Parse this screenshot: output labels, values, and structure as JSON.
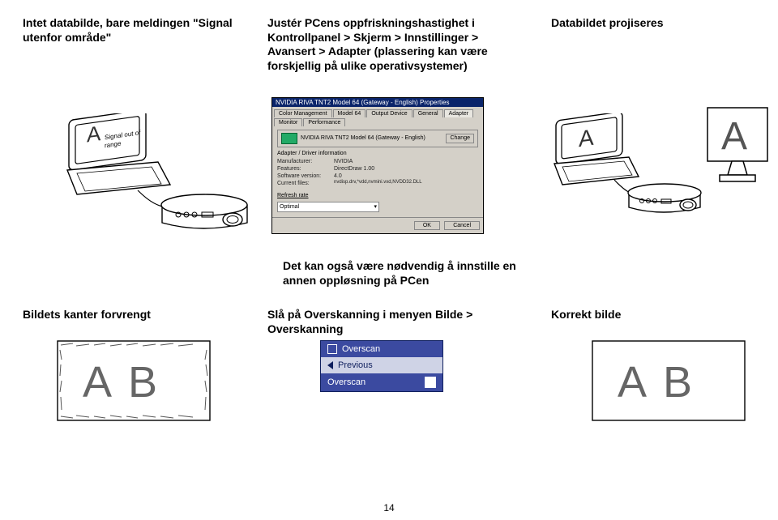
{
  "row1": {
    "left_heading": "Intet databilde, bare meldingen \"Signal utenfor område\"",
    "mid_text": "Justér PCens oppfriskningshastighet i Kontrollpanel > Skjerm > Innstillinger > Avansert > Adapter (plassering kan være forskjellig på ulike operativsystemer)",
    "right_heading": "Databildet projiseres",
    "signal_msg_line1": "Signal out of",
    "signal_msg_line2": "range",
    "screen_A_left": "A",
    "screen_A_right": "A",
    "monitor_A": "A",
    "dialog": {
      "title": "NVIDIA RIVA TNT2 Model 64 (Gateway - English) Properties",
      "tabs_row1": [
        "Color Management",
        "Model 64",
        "Output Device"
      ],
      "tabs_row2": [
        "General",
        "Adapter",
        "Monitor",
        "Performance"
      ],
      "active_tab": "Adapter",
      "card_name": "NVIDIA RIVA TNT2 Model 64 (Gateway - English)",
      "change_btn": "Change",
      "section": "Adapter / Driver information",
      "kv": [
        {
          "k": "Manufacturer:",
          "v": "NVIDIA"
        },
        {
          "k": "Features:",
          "v": "DirectDraw 1.00"
        },
        {
          "k": "Software version:",
          "v": "4.0"
        },
        {
          "k": "Current files:",
          "v": "nvdisp.drv,*vdd,nvmini.vxd,NVDD32.DLL"
        }
      ],
      "rate_label": "Refresh rate",
      "rate_value": "Optimal",
      "ok": "OK",
      "cancel": "Cancel"
    },
    "tip": "Det kan også være nødvendig å innstille en annen oppløsning på PCen"
  },
  "row2": {
    "left_heading": "Bildets kanter forvrengt",
    "mid_heading": "Slå på Overskanning i menyen Bilde > Overskanning",
    "right_heading": "Korrekt bilde",
    "AB_left": "A B",
    "AB_right": "A B",
    "osd": {
      "item1": "Overscan",
      "item2": "Previous",
      "item3": "Overscan"
    }
  },
  "page_number": "14"
}
